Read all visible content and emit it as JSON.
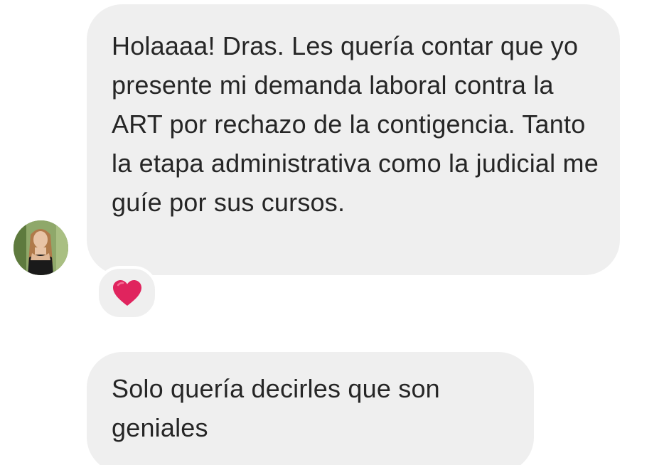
{
  "messages": [
    {
      "text": "Holaaaa! Dras. Les quería contar que yo presente mi demanda laboral contra la ART por rechazo de la contigencia. Tanto la etapa administrativa como la judicial me guíe por sus cursos.",
      "reaction": "heart-icon"
    },
    {
      "text": "Solo quería decirles que son geniales"
    }
  ],
  "colors": {
    "bubble": "#efefef",
    "text": "#262626",
    "heart": "#e0245e"
  }
}
